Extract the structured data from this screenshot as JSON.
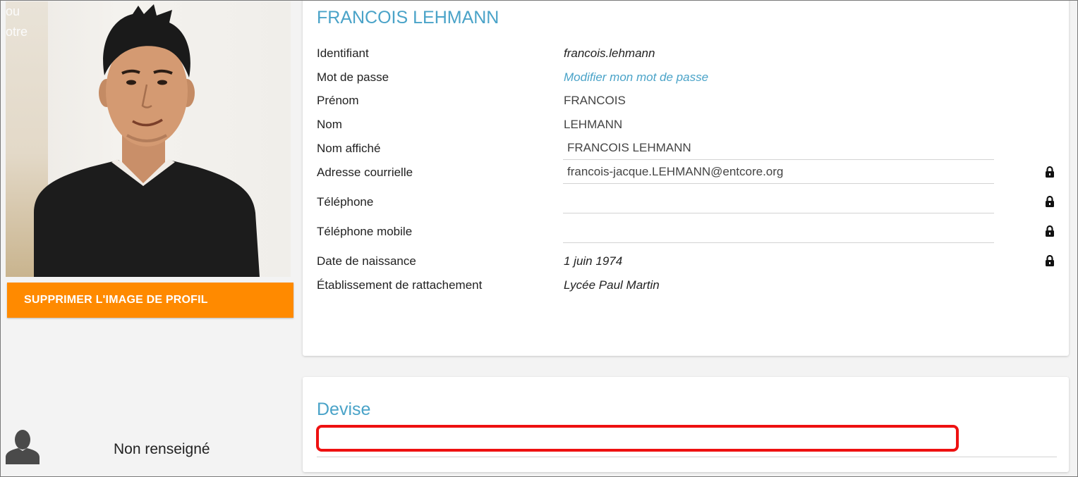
{
  "sidebar": {
    "ghost_text_1": "ou",
    "ghost_text_2": "otre",
    "delete_photo_label": "SUPPRIMER L'IMAGE DE PROFIL",
    "motto_status": "Non renseigné"
  },
  "profile": {
    "full_name": "FRANCOIS LEHMANN",
    "rows": {
      "login": {
        "label": "Identifiant",
        "value": "francois.lehmann"
      },
      "password": {
        "label": "Mot de passe",
        "link": "Modifier mon mot de passe"
      },
      "first_name": {
        "label": "Prénom",
        "value": "FRANCOIS"
      },
      "last_name": {
        "label": "Nom",
        "value": "LEHMANN"
      },
      "display_name": {
        "label": "Nom affiché",
        "value": "FRANCOIS LEHMANN"
      },
      "email": {
        "label": "Adresse courrielle",
        "value": "francois-jacque.LEHMANN@entcore.org"
      },
      "phone": {
        "label": "Téléphone",
        "value": ""
      },
      "mobile": {
        "label": "Téléphone mobile",
        "value": ""
      },
      "birthdate": {
        "label": "Date de naissance",
        "value": "1 juin 1974"
      },
      "school": {
        "label": "Établissement de rattachement",
        "value": "Lycée Paul Martin"
      }
    }
  },
  "motto": {
    "title": "Devise",
    "value": ""
  },
  "colors": {
    "accent": "#4aa3c8",
    "button": "#ff8a00",
    "highlight": "#ee1111"
  },
  "icons": {
    "lock": "lock-icon",
    "user": "user-silhouette-icon"
  }
}
